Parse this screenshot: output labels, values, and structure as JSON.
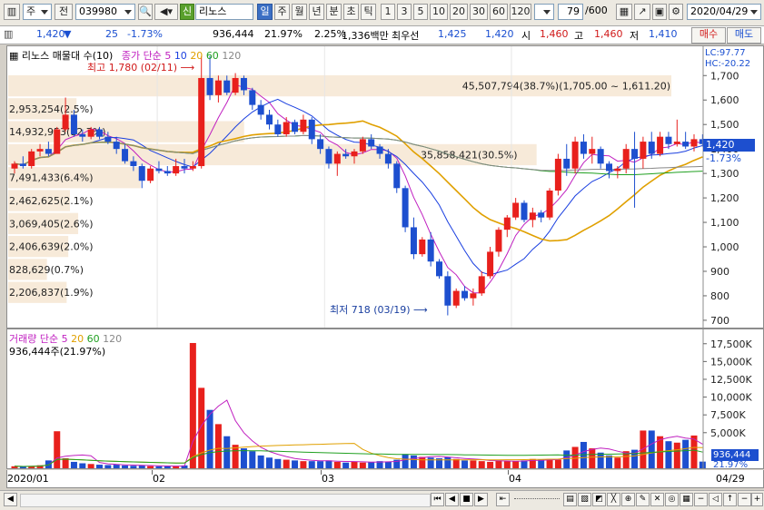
{
  "toolbar": {
    "type_btn": "주",
    "prev_btn": "전",
    "stock_code": "039980",
    "stock_tag": "신",
    "stock_name": "리노스",
    "periods": [
      "일",
      "주",
      "월",
      "년",
      "분",
      "초",
      "틱"
    ],
    "active_period": "일",
    "minutes": [
      "1",
      "3",
      "5",
      "10",
      "20",
      "30",
      "60",
      "120"
    ],
    "count": "79",
    "count_total": "/600",
    "date": "2020/04/29"
  },
  "quote": {
    "price": "1,420",
    "change": "25",
    "change_pct": "-1.73%",
    "volume": "936,444",
    "turnover": "21.97%",
    "ratio": "2.25%",
    "amount": "1,336백만",
    "best_label": "최우선",
    "ask": "1,425",
    "bid": "1,420",
    "open_label": "시",
    "open": "1,460",
    "high_label": "고",
    "high": "1,460",
    "low_label": "저",
    "low": "1,410",
    "buy_btn": "매수",
    "sell_btn": "매도"
  },
  "price_panel": {
    "legend_name": "리노스 매물대 수(10)",
    "legend_close": "종가 단순",
    "ma_periods": [
      "5",
      "10",
      "20",
      "60",
      "120"
    ],
    "ma_colors": [
      "#c020c0",
      "#1a3fe0",
      "#e0a000",
      "#20a020",
      "#888888"
    ],
    "lc": "LC:97.77",
    "hc": "HC:-20.22",
    "high_note": "최고 1,780 (02/11)",
    "low_note": "최저 718 (03/19)",
    "current_tag": "1,420",
    "current_pct": "-1.73%",
    "profile_top": "45,507,794(38.7%)(1,705.00 ~ 1,611.20)"
  },
  "volume_panel": {
    "legend_name": "거래량",
    "legend_ma": "단순",
    "ma_periods": [
      "5",
      "20",
      "60",
      "120"
    ],
    "current": "936,444주(21.97%)",
    "tag": "936,444",
    "tag_pct": "21.97%"
  },
  "x_axis": {
    "labels": [
      "2020/01",
      "02",
      "03",
      "04"
    ],
    "end_label": "04/29"
  },
  "colors": {
    "up": "#e8201c",
    "down": "#1d4fcf",
    "profile": "#f7ead9"
  },
  "chart_data": {
    "type": "candlestick",
    "price_axis": {
      "ticks": [
        700,
        800,
        900,
        1000,
        1100,
        1200,
        1300,
        1400,
        1500,
        1600,
        1700
      ],
      "ylim": [
        670,
        1790
      ]
    },
    "volume_axis": {
      "ticks": [
        5000,
        7500,
        10000,
        12500,
        15000,
        17500
      ],
      "unit": "K",
      "ylim": [
        0,
        19000
      ]
    },
    "candles": [
      [
        1320,
        1350,
        1300,
        1340
      ],
      [
        1340,
        1370,
        1320,
        1330
      ],
      [
        1330,
        1400,
        1320,
        1390
      ],
      [
        1390,
        1420,
        1370,
        1400
      ],
      [
        1400,
        1430,
        1370,
        1380
      ],
      [
        1380,
        1490,
        1380,
        1480
      ],
      [
        1480,
        1610,
        1470,
        1540
      ],
      [
        1540,
        1560,
        1450,
        1460
      ],
      [
        1460,
        1480,
        1430,
        1450
      ],
      [
        1450,
        1490,
        1440,
        1480
      ],
      [
        1480,
        1490,
        1440,
        1450
      ],
      [
        1450,
        1470,
        1420,
        1430
      ],
      [
        1430,
        1450,
        1380,
        1400
      ],
      [
        1400,
        1420,
        1340,
        1350
      ],
      [
        1350,
        1370,
        1310,
        1330
      ],
      [
        1330,
        1340,
        1240,
        1270
      ],
      [
        1270,
        1330,
        1260,
        1320
      ],
      [
        1320,
        1350,
        1300,
        1310
      ],
      [
        1310,
        1330,
        1290,
        1300
      ],
      [
        1300,
        1360,
        1290,
        1330
      ],
      [
        1330,
        1360,
        1300,
        1320
      ],
      [
        1320,
        1350,
        1310,
        1330
      ],
      [
        1330,
        1780,
        1320,
        1690
      ],
      [
        1690,
        1780,
        1600,
        1620
      ],
      [
        1620,
        1700,
        1590,
        1680
      ],
      [
        1680,
        1700,
        1620,
        1630
      ],
      [
        1630,
        1710,
        1620,
        1690
      ],
      [
        1690,
        1700,
        1620,
        1640
      ],
      [
        1640,
        1650,
        1560,
        1580
      ],
      [
        1580,
        1600,
        1520,
        1540
      ],
      [
        1540,
        1560,
        1480,
        1500
      ],
      [
        1500,
        1520,
        1450,
        1460
      ],
      [
        1460,
        1530,
        1450,
        1510
      ],
      [
        1510,
        1520,
        1460,
        1470
      ],
      [
        1470,
        1540,
        1460,
        1520
      ],
      [
        1520,
        1530,
        1420,
        1440
      ],
      [
        1440,
        1460,
        1380,
        1400
      ],
      [
        1400,
        1410,
        1320,
        1340
      ],
      [
        1340,
        1390,
        1290,
        1380
      ],
      [
        1380,
        1400,
        1360,
        1370
      ],
      [
        1370,
        1400,
        1340,
        1390
      ],
      [
        1390,
        1450,
        1380,
        1440
      ],
      [
        1440,
        1460,
        1400,
        1410
      ],
      [
        1410,
        1420,
        1360,
        1380
      ],
      [
        1380,
        1400,
        1320,
        1340
      ],
      [
        1340,
        1350,
        1220,
        1240
      ],
      [
        1240,
        1250,
        1060,
        1080
      ],
      [
        1080,
        1120,
        950,
        970
      ],
      [
        970,
        1040,
        960,
        1030
      ],
      [
        1030,
        1060,
        920,
        940
      ],
      [
        940,
        950,
        870,
        880
      ],
      [
        880,
        900,
        720,
        760
      ],
      [
        760,
        830,
        750,
        820
      ],
      [
        820,
        840,
        780,
        790
      ],
      [
        790,
        830,
        760,
        810
      ],
      [
        810,
        900,
        800,
        880
      ],
      [
        880,
        1000,
        870,
        980
      ],
      [
        980,
        1080,
        960,
        1070
      ],
      [
        1070,
        1130,
        1040,
        1120
      ],
      [
        1120,
        1200,
        1110,
        1180
      ],
      [
        1180,
        1190,
        1100,
        1110
      ],
      [
        1110,
        1160,
        1080,
        1140
      ],
      [
        1140,
        1150,
        1100,
        1120
      ],
      [
        1120,
        1240,
        1110,
        1230
      ],
      [
        1230,
        1380,
        1210,
        1360
      ],
      [
        1360,
        1420,
        1290,
        1320
      ],
      [
        1320,
        1450,
        1300,
        1430
      ],
      [
        1430,
        1460,
        1360,
        1380
      ],
      [
        1380,
        1450,
        1340,
        1400
      ],
      [
        1400,
        1410,
        1320,
        1340
      ],
      [
        1340,
        1350,
        1280,
        1310
      ],
      [
        1310,
        1330,
        1280,
        1320
      ],
      [
        1320,
        1420,
        1300,
        1400
      ],
      [
        1400,
        1470,
        1160,
        1360
      ],
      [
        1360,
        1450,
        1320,
        1430
      ],
      [
        1430,
        1470,
        1360,
        1380
      ],
      [
        1380,
        1470,
        1370,
        1450
      ],
      [
        1450,
        1470,
        1400,
        1420
      ],
      [
        1420,
        1520,
        1410,
        1430
      ],
      [
        1430,
        1470,
        1400,
        1410
      ],
      [
        1410,
        1460,
        1390,
        1440
      ],
      [
        1440,
        1460,
        1410,
        1420
      ]
    ],
    "volumes": [
      280,
      220,
      300,
      420,
      1100,
      5200,
      1400,
      900,
      700,
      600,
      500,
      450,
      500,
      400,
      350,
      380,
      300,
      280,
      260,
      300,
      400,
      17600,
      11300,
      8200,
      6200,
      4500,
      3300,
      2800,
      2400,
      1800,
      1500,
      1300,
      1200,
      1100,
      1000,
      1000,
      1000,
      1100,
      900,
      800,
      900,
      800,
      900,
      1000,
      900,
      1200,
      2000,
      1800,
      1600,
      1500,
      1400,
      1600,
      1300,
      1100,
      1100,
      1000,
      900,
      1100,
      1000,
      1000,
      1100,
      1300,
      1200,
      1300,
      1200,
      2500,
      3000,
      3700,
      2800,
      2200,
      1800,
      1500,
      2400,
      2600,
      5300,
      5300,
      4500,
      3800,
      3600,
      4000,
      4600,
      936
    ],
    "profile": [
      {
        "label": "45,507,794(38.7%)(1,705.00 ~ 1,611.20)",
        "low": 1611.2,
        "high": 1705.0,
        "pct": 38.7
      },
      {
        "label": "2,953,254(2.5%)",
        "low": 1517.4,
        "high": 1611.2,
        "pct": 2.5
      },
      {
        "label": "14,932,953(12.7%)",
        "low": 1423.6,
        "high": 1517.4,
        "pct": 12.7
      },
      {
        "label": "35,858,421(30.5%)",
        "low": 1329.8,
        "high": 1423.6,
        "pct": 30.5
      },
      {
        "label": "7,491,433(6.4%)",
        "low": 1236.0,
        "high": 1329.8,
        "pct": 6.4
      },
      {
        "label": "2,462,625(2.1%)",
        "low": 1142.2,
        "high": 1236.0,
        "pct": 2.1
      },
      {
        "label": "3,069,405(2.6%)",
        "low": 1048.4,
        "high": 1142.2,
        "pct": 2.6
      },
      {
        "label": "2,406,639(2.0%)",
        "low": 954.6,
        "high": 1048.4,
        "pct": 2.0
      },
      {
        "label": "828,629(0.7%)",
        "low": 860.8,
        "high": 954.6,
        "pct": 0.7
      },
      {
        "label": "2,206,837(1.9%)",
        "low": 767.0,
        "high": 860.8,
        "pct": 1.9
      }
    ]
  }
}
